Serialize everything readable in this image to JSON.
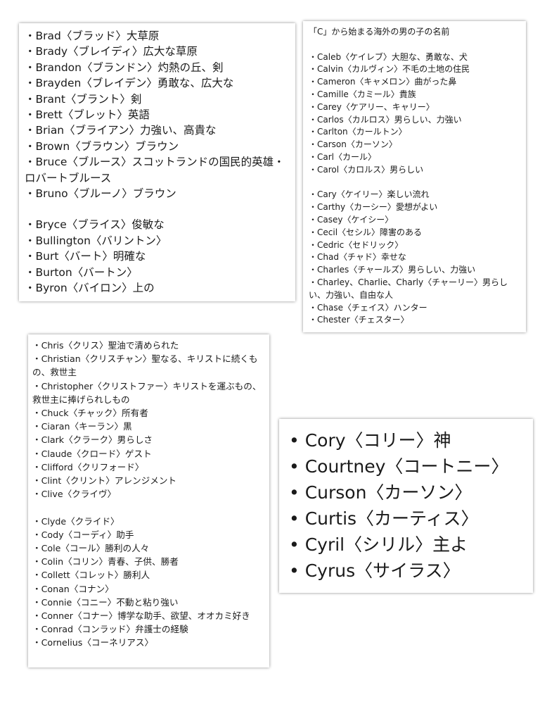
{
  "card_b": {
    "lines": [
      "・Brad〈ブラッド〉大草原",
      "・Brady〈ブレイディ〉広大な草原",
      "・Brandon〈ブランドン〉灼熱の丘、剣",
      "・Brayden〈ブレイデン〉勇敢な、広大な",
      "・Brant〈ブラント〉剣",
      "・Brett〈ブレット〉英語",
      "・Brian〈ブライアン〉力強い、高貴な",
      "・Brown〈ブラウン〉ブラウン",
      "・Bruce〈ブルース〉スコットランドの国民的英雄・ロバートブルース",
      "・Bruno〈ブルーノ〉ブラウン"
    ],
    "lines2": [
      "・Bryce〈ブライス〉俊敏な",
      "・Bullington〈バリントン〉",
      "・Burt〈バート〉明確な",
      "・Burton〈バートン〉",
      "・Byron〈バイロン〉上の"
    ]
  },
  "card_c1": {
    "title": "「C」から始まる海外の男の子の名前",
    "lines": [
      "・Caleb〈ケイレブ〉大胆な、勇敢な、犬",
      "・Calvin〈カルヴィン〉不毛の土地の住民",
      "・Cameron〈キャメロン〉曲がった鼻",
      "・Camille〈カミール〉貴族",
      "・Carey〈ケアリー、キャリー〉",
      "・Carlos〈カルロス〉男らしい、力強い",
      "・Carlton〈カールトン〉",
      "・Carson〈カーソン〉",
      "・Carl〈カール〉",
      "・Carol〈カロルス〉男らしい"
    ],
    "lines2": [
      "・Cary〈ケイリー〉楽しい流れ",
      "・Carthy〈カーシー〉愛想がよい",
      "・Casey〈ケイシー〉",
      "・Cecil〈セシル〉障害のある",
      "・Cedric〈セドリック〉",
      "・Chad〈チャド〉幸せな",
      "・Charles〈チャールズ〉男らしい、力強い",
      "・Charley、Charlie、Charly〈チャーリー〉男らしい、力強い、自由な人",
      "・Chase〈チェイス〉ハンター",
      "・Chester〈チェスター〉"
    ]
  },
  "card_c2": {
    "lines": [
      "・Chris〈クリス〉聖油で清められた",
      "・Christian〈クリスチャン〉聖なる、キリストに続くもの、救世主",
      "・Christopher〈クリストファー〉キリストを運ぶもの、救世主に捧げられしもの",
      "・Chuck〈チャック〉所有者",
      "・Ciaran〈キーラン〉黒",
      "・Clark〈クラーク〉男らしさ",
      "・Claude〈クロード〉ゲスト",
      "・Clifford〈クリフォード〉",
      "・Clint〈クリント〉アレンジメント",
      "・Clive〈クライヴ〉"
    ],
    "lines2": [
      "・Clyde〈クライド〉",
      "・Cody〈コーディ〉助手",
      "・Cole〈コール〉勝利の人々",
      "・Colin〈コリン〉青春、子供、勝者",
      "・Collett〈コレット〉勝利人",
      "・Conan〈コナン〉",
      "・Connie〈コニー〉不動と粘り強い",
      "・Conner〈コナー〉博学な助手、欲望、オオカミ好き",
      "・Conrad〈コンラッド〉弁護士の経験",
      "・Cornelius〈コーネリアス〉"
    ]
  },
  "card_c3": {
    "lines": [
      "• Cory〈コリー〉神",
      "• Courtney〈コートニー〉",
      "• Curson〈カーソン〉",
      "• Curtis〈カーティス〉",
      "• Cyril〈シリル〉主よ",
      "• Cyrus〈サイラス〉"
    ]
  }
}
